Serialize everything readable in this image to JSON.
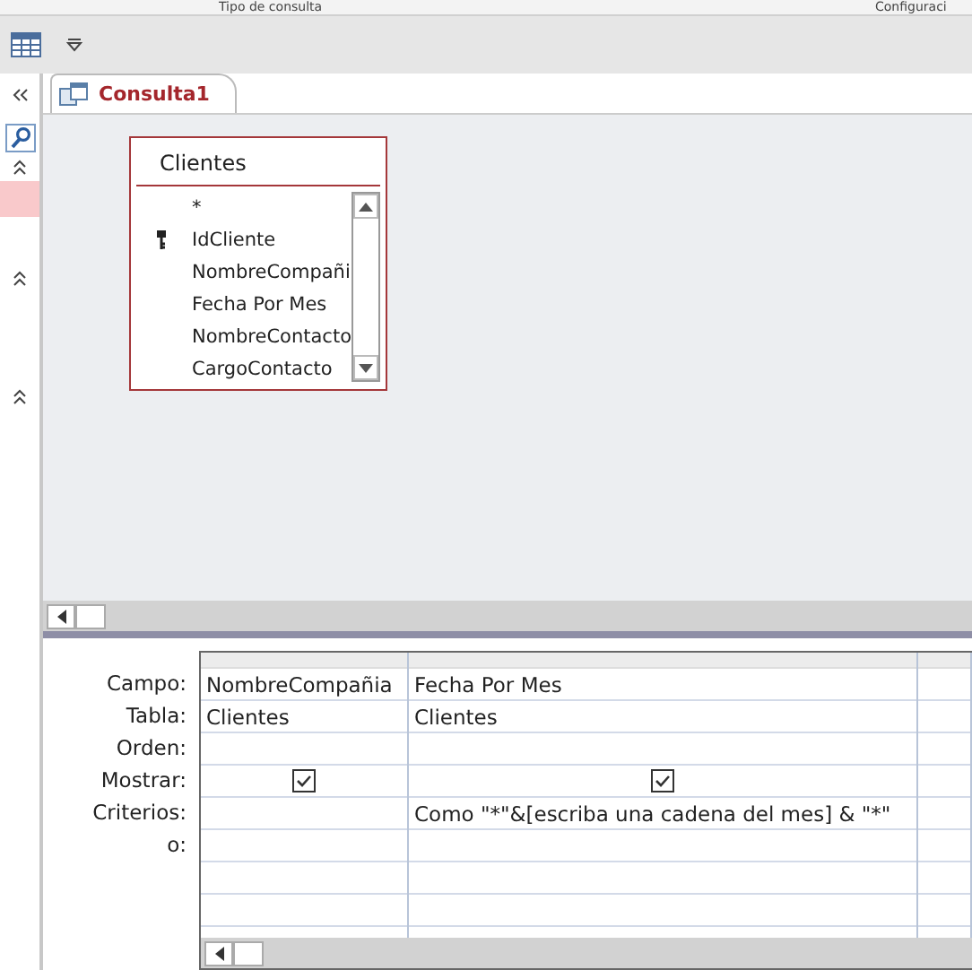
{
  "ribbon_groups": [
    "Tipo de consulta",
    "Configuraci"
  ],
  "tab": {
    "label": "Consulta1",
    "selected": true
  },
  "field_list": {
    "title": "Clientes",
    "fields": [
      {
        "name": "*",
        "key": false
      },
      {
        "name": "IdCliente",
        "key": true
      },
      {
        "name": "NombreCompañi",
        "key": false
      },
      {
        "name": "Fecha Por Mes",
        "key": false
      },
      {
        "name": "NombreContacto",
        "key": false
      },
      {
        "name": "CargoContacto",
        "key": false
      }
    ]
  },
  "grid": {
    "row_labels": [
      "Campo:",
      "Tabla:",
      "Orden:",
      "Mostrar:",
      "Criterios:",
      "o:"
    ],
    "columns": [
      {
        "field": "NombreCompañia",
        "table": "Clientes",
        "show": true
      },
      {
        "field": "Fecha Por Mes",
        "table": "Clientes",
        "show": true,
        "criteria": "Como \"*\"&[escriba una cadena del mes] & \"*\""
      }
    ]
  }
}
